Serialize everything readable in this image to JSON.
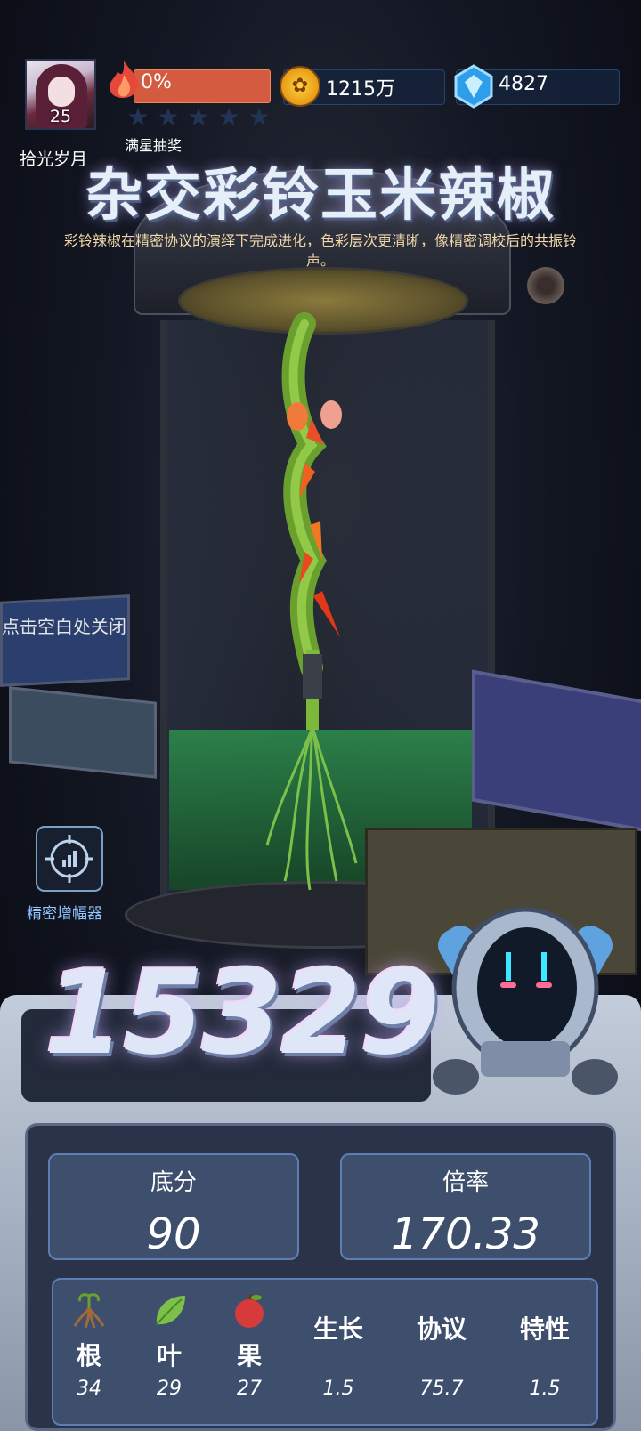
{
  "player": {
    "level": "25",
    "name": "拾光岁月"
  },
  "star_progress": {
    "percent_text": "0%",
    "stars_filled": 0,
    "stars_total": 5,
    "label": "满星抽奖"
  },
  "resources": {
    "gold": "1215万",
    "gems": "4827"
  },
  "title": "杂交彩铃玉米辣椒",
  "subtitle": "彩铃辣椒在精密协议的演绎下完成进化，色彩层次更清晰，像精密调校后的共振铃声。",
  "close_hint": "点击空白处关闭",
  "amplifier": {
    "label": "精密增幅器",
    "icon": "crosshair-chart-icon"
  },
  "score": "15329",
  "stats": {
    "base_label": "底分",
    "base_value": "90",
    "mult_label": "倍率",
    "mult_value": "170.33"
  },
  "traits": [
    {
      "label": "根",
      "value": "34",
      "icon": "root-icon"
    },
    {
      "label": "叶",
      "value": "29",
      "icon": "leaf-icon"
    },
    {
      "label": "果",
      "value": "27",
      "icon": "apple-icon"
    },
    {
      "label": "生长",
      "value": "1.5"
    },
    {
      "label": "协议",
      "value": "75.7"
    },
    {
      "label": "特性",
      "value": "1.5"
    }
  ],
  "colors": {
    "progress": "#d45b3f",
    "panel": "#3e4f6e",
    "accent": "#8fc4ff",
    "gold": "#ffd23c"
  }
}
